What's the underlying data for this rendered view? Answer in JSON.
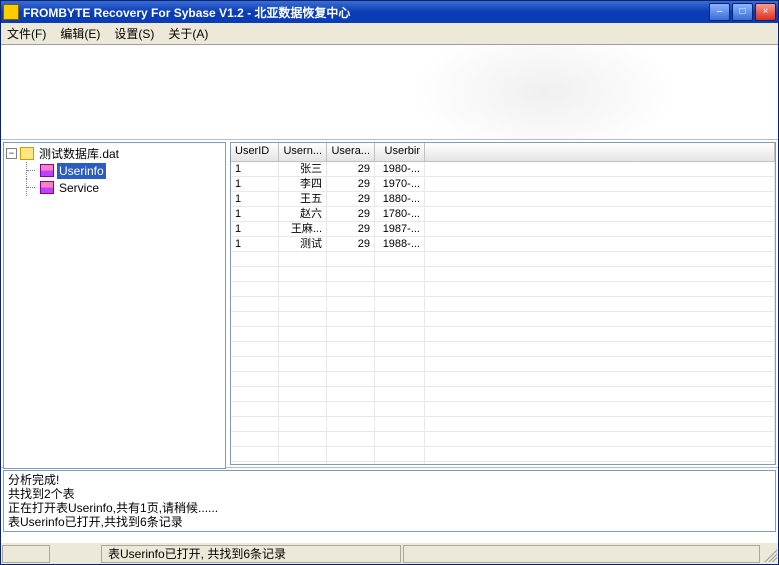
{
  "titlebar": {
    "title": "FROMBYTE Recovery For Sybase V1.2 - 北亚数据恢复中心",
    "min_glyph": "–",
    "max_glyph": "□",
    "close_glyph": "×"
  },
  "menubar": {
    "file": "文件(F)",
    "edit": "编辑(E)",
    "settings": "设置(S)",
    "about": "关于(A)"
  },
  "tree": {
    "root_label": "测试数据库.dat",
    "root_toggle": "−",
    "items": [
      {
        "label": "Userinfo",
        "selected": true
      },
      {
        "label": "Service",
        "selected": false
      }
    ]
  },
  "grid": {
    "columns": [
      {
        "label": "UserID"
      },
      {
        "label": "Usern..."
      },
      {
        "label": "Usera..."
      },
      {
        "label": "Userbir"
      }
    ],
    "rows": [
      {
        "c0": "1",
        "c1": "张三",
        "c2": "29",
        "c3": "1980-..."
      },
      {
        "c0": "1",
        "c1": "李四",
        "c2": "29",
        "c3": "1970-..."
      },
      {
        "c0": "1",
        "c1": "王五",
        "c2": "29",
        "c3": "1880-..."
      },
      {
        "c0": "1",
        "c1": "赵六",
        "c2": "29",
        "c3": "1780-..."
      },
      {
        "c0": "1",
        "c1": "王麻...",
        "c2": "29",
        "c3": "1987-..."
      },
      {
        "c0": "1",
        "c1": "测试",
        "c2": "29",
        "c3": "1988-..."
      }
    ],
    "empty_row_count": 19
  },
  "log": {
    "lines": [
      "分析完成!",
      "共找到2个表",
      "正在打开表Userinfo,共有1页,请稍候......",
      "表Userinfo已打开,共找到6条记录"
    ]
  },
  "statusbar": {
    "text": "表Userinfo已打开, 共找到6条记录"
  }
}
